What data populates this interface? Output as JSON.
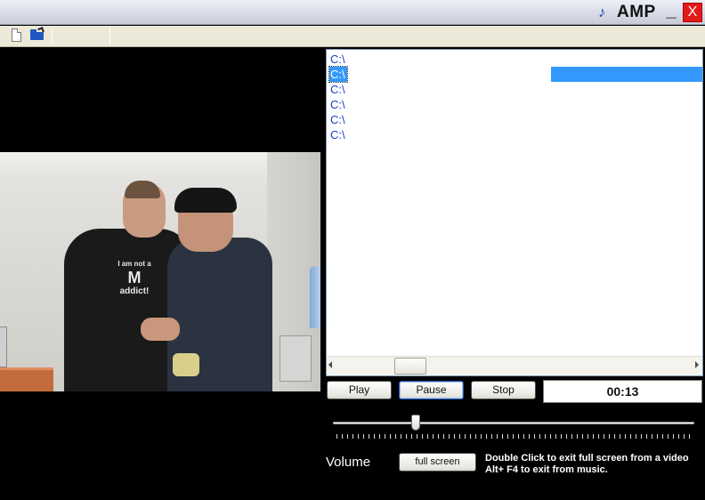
{
  "window": {
    "title": "AMP",
    "icon": "music-note-icon",
    "minimize_label": "_",
    "close_label": "X",
    "colors": {
      "close": "#e21a1a",
      "selection": "#3399ff",
      "background": "#000000"
    }
  },
  "toolbar": {
    "items": [
      {
        "icon": "new-file-icon"
      },
      {
        "icon": "open-folder-icon"
      }
    ]
  },
  "video": {
    "shirt_text": "I am not a\nM\naddict!"
  },
  "playlist": {
    "items": [
      {
        "label": "C:\\",
        "selected": false
      },
      {
        "label": "C:\\",
        "selected": true
      },
      {
        "label": "C:\\",
        "selected": false
      },
      {
        "label": "C:\\",
        "selected": false
      },
      {
        "label": "C:\\",
        "selected": false
      },
      {
        "label": "C:\\",
        "selected": false
      }
    ]
  },
  "controls": {
    "play_label": "Play",
    "pause_label": "Pause",
    "stop_label": "Stop",
    "time": "00:13",
    "seek_position_fraction": 0.23,
    "volume_label": "Volume",
    "fullscreen_label": "full screen",
    "hint_line1": "Double Click to exit full screen from a video",
    "hint_line2": "Alt+ F4 to exit from music."
  }
}
